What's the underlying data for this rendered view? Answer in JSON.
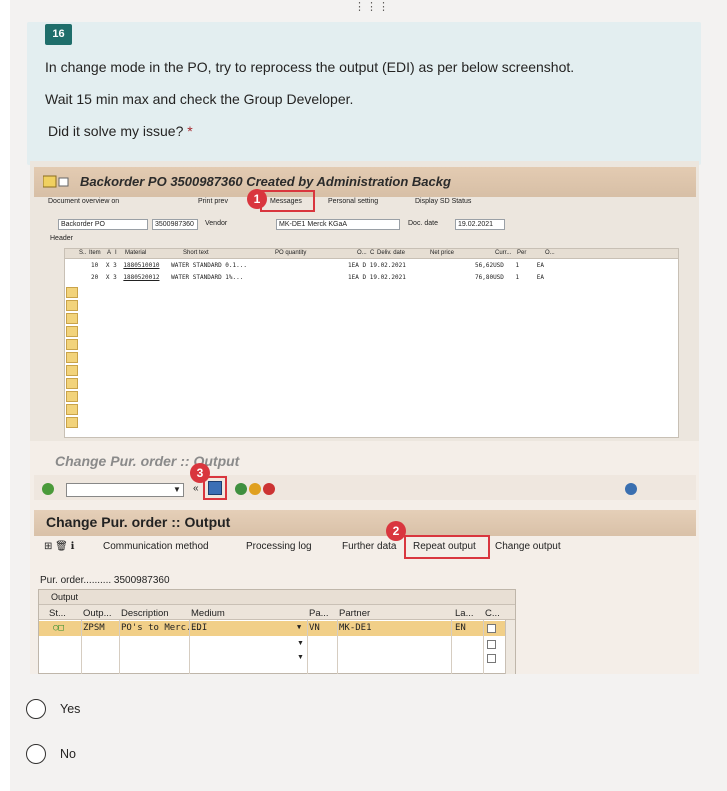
{
  "question": {
    "number": "16",
    "line1": "In change mode in the PO, try to reprocess the output (EDI) as per below screenshot.",
    "line2": "Wait 15 min max and check the Group Developer.",
    "prompt": "Did it solve my issue?",
    "required_mark": "*"
  },
  "screenshot": {
    "window_a": {
      "title": "Backorder PO 3500987360 Created by Administration Backg",
      "toolbar": [
        "Document overview on",
        "Print prev",
        "Messages",
        "Personal setting",
        "Display SD Status"
      ],
      "doc_type": "Backorder PO",
      "po_number": "3500987360",
      "vendor_label": "Vendor",
      "vendor": "MK-DE1 Merck KGaA",
      "doc_date_label": "Doc. date",
      "doc_date": "19.02.2021",
      "header_label": "Header",
      "columns": [
        "S..",
        "Item",
        "A",
        "I",
        "Material",
        "Short text",
        "PO quantity",
        "O...",
        "C",
        "Deliv. date",
        "Net price",
        "Curr...",
        "Per",
        "O..."
      ],
      "rows": [
        [
          "10",
          "X",
          "3",
          "1880510010",
          "WATER STANDARD 0.1...",
          "1",
          "EA",
          "D",
          "19.02.2021",
          "56,62",
          "USD",
          "1",
          "EA"
        ],
        [
          "20",
          "X",
          "3",
          "1880520012",
          "WATER STANDARD 1%...",
          "1",
          "EA",
          "D",
          "19.02.2021",
          "76,80",
          "USD",
          "1",
          "EA"
        ]
      ]
    },
    "window_b": {
      "faded_title": "Change Pur. order :: Output",
      "title": "Change Pur. order :: Output",
      "app_toolbar": [
        "Communication method",
        "Processing log",
        "Further data",
        "Repeat output",
        "Change output"
      ],
      "po_label": "Pur. order.......... 3500987360",
      "table_caption": "Output",
      "columns": [
        "St...",
        "Outp...",
        "Description",
        "Medium",
        "Pa...",
        "Partner",
        "La...",
        "C..."
      ],
      "row": [
        "ZPSM",
        "PO's to Merc...",
        "EDI",
        "VN",
        "MK-DE1",
        "EN"
      ]
    },
    "callouts": [
      "1",
      "2",
      "3"
    ]
  },
  "options": [
    {
      "label": "Yes"
    },
    {
      "label": "No"
    }
  ],
  "colors": {
    "badge": "#1f6e6b",
    "card": "#e3eef0",
    "callout": "#d9363e",
    "required": "#a4262c"
  }
}
